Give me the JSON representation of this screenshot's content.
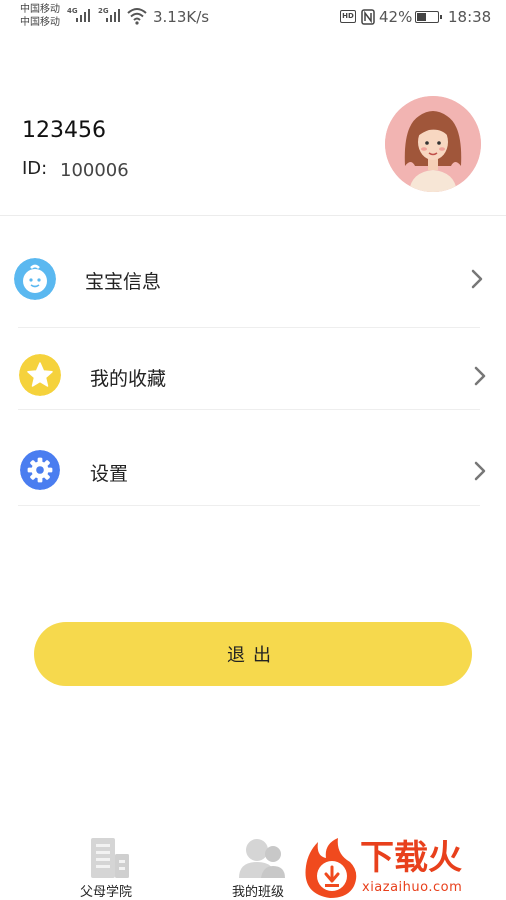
{
  "status_bar": {
    "carrier_1": "中国移动",
    "carrier_2": "中国移动",
    "net_1": "4G",
    "net_2": "2G",
    "speed": "3.13K/s",
    "battery_percent": "42%",
    "battery_level": 0.42,
    "time": "18:38"
  },
  "profile": {
    "username": "123456",
    "id_label": "ID:",
    "id_value": "100006"
  },
  "menu": {
    "items": [
      {
        "label": "宝宝信息",
        "icon": "baby-face-icon",
        "color": "#5ab8f0"
      },
      {
        "label": "我的收藏",
        "icon": "star-icon",
        "color": "#f5d23c"
      },
      {
        "label": "设置",
        "icon": "gear-icon",
        "color": "#4a7df0"
      }
    ]
  },
  "logout": {
    "label": "退出",
    "color": "#f6d94d"
  },
  "bottom_nav": {
    "items": [
      {
        "label": "父母学院",
        "icon": "building-icon"
      },
      {
        "label": "我的班级",
        "icon": "class-group-icon"
      }
    ]
  },
  "watermark": {
    "text": "下载火",
    "url": "xiazaihuo.com"
  }
}
